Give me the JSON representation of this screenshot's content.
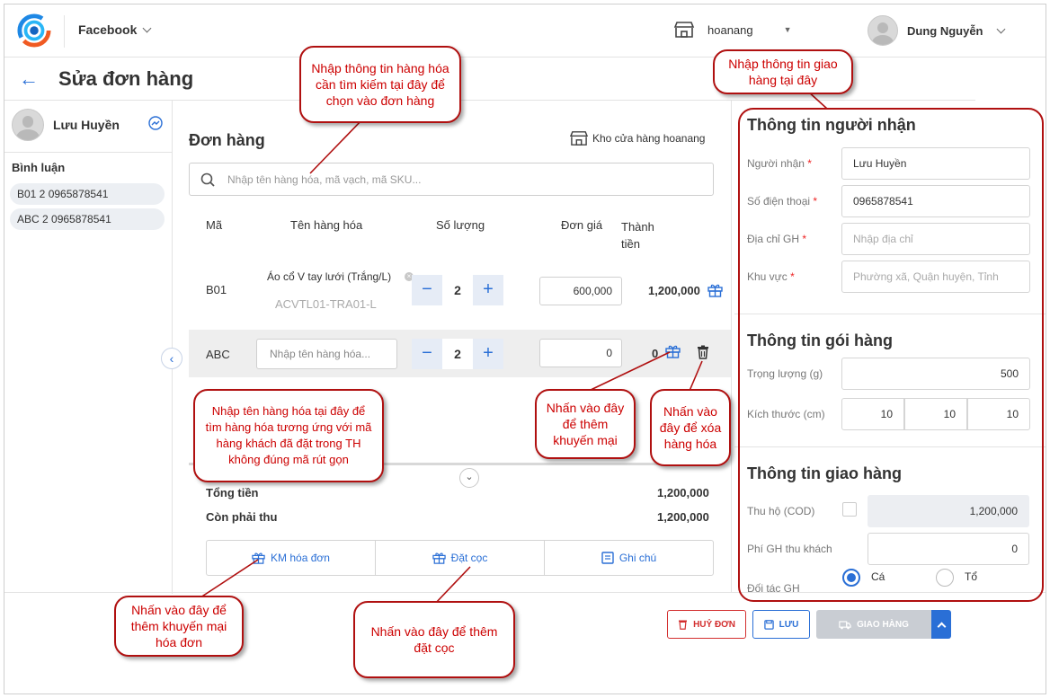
{
  "topbar": {
    "channel": "Facebook",
    "store": "hoanang",
    "user": "Dung Nguyễn"
  },
  "page": {
    "title": "Sửa đơn hàng"
  },
  "left": {
    "customer": "Lưu Huyền",
    "comments_label": "Bình luận",
    "comments": [
      "B01 2 0965878541",
      "ABC 2 0965878541"
    ]
  },
  "order": {
    "title": "Đơn hàng",
    "warehouse": "Kho cửa hàng hoanang",
    "search_placeholder": "Nhập tên hàng hóa, mã vạch, mã SKU...",
    "columns": {
      "code": "Mã",
      "name": "Tên hàng hóa",
      "qty": "Số lượng",
      "price": "Đơn giá",
      "total_1": "Thành",
      "total_2": "tiền"
    },
    "rows": [
      {
        "code": "B01",
        "name": "Áo cổ V tay lưới (Trắng/L)",
        "sku": "ACVTL01-TRA01-L",
        "qty": "2",
        "price": "600,000",
        "total": "1,200,000"
      },
      {
        "code": "ABC",
        "name_placeholder": "Nhập tên hàng hóa...",
        "qty": "2",
        "price": "0",
        "total": "0"
      }
    ],
    "summary": {
      "total_label": "Tổng tiền",
      "total_value": "1,200,000",
      "due_label": "Còn phải thu",
      "due_value": "1,200,000"
    },
    "tabs": [
      "KM hóa đơn",
      "Đặt cọc",
      "Ghi chú"
    ]
  },
  "recipient": {
    "title": "Thông tin người nhận",
    "name_label": "Người nhận",
    "name_value": "Lưu Huyền",
    "phone_label": "Số điện thoại",
    "phone_value": "0965878541",
    "address_label": "Địa chỉ GH",
    "address_placeholder": "Nhập địa chỉ",
    "area_label": "Khu vực",
    "area_placeholder": "Phường xã, Quận huyện, Tỉnh"
  },
  "package": {
    "title": "Thông tin gói hàng",
    "weight_label": "Trọng lượng (g)",
    "weight_value": "500",
    "size_label": "Kích thước (cm)",
    "size_values": [
      "10",
      "10",
      "10"
    ]
  },
  "delivery": {
    "title": "Thông tin giao hàng",
    "cod_label": "Thu hộ (COD)",
    "cod_value": "1,200,000",
    "fee_label": "Phí GH thu khách",
    "fee_value": "0",
    "partner_label": "Đối tác GH",
    "partner_options": [
      "Cá",
      "Tổ"
    ]
  },
  "actions": {
    "cancel": "HUỶ ĐƠN",
    "save": "LƯU",
    "ship": "GIAO HÀNG"
  },
  "annotations": {
    "search": "Nhập thông tin hàng hóa cần tìm kiếm tại đây để chọn vào đơn hàng",
    "delivery": "Nhập thông tin giao hàng tại đây",
    "name_input": "Nhập tên hàng hóa tại đây để tìm hàng hóa tương ứng với mã hàng khách đã đặt trong TH không đúng mã rút gọn",
    "promo": "Nhấn vào đây để thêm khuyến mại",
    "delete": "Nhấn vào đây để xóa hàng hóa",
    "invoice_promo": "Nhấn vào đây để thêm khuyến mại hóa đơn",
    "deposit": "Nhấn vào đây để thêm đặt cọc"
  },
  "colors": {
    "accent": "#2a6fd6",
    "annotation": "#b01010",
    "danger": "#d32f2f"
  }
}
